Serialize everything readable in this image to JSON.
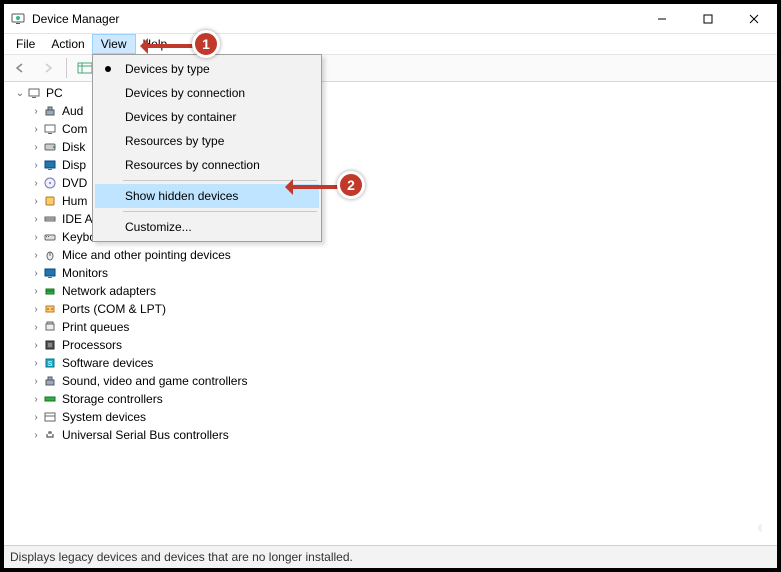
{
  "title": "Device Manager",
  "menus": {
    "file": "File",
    "action": "Action",
    "view": "View",
    "help": "Help"
  },
  "view_menu": {
    "devices_by_type": "Devices by type",
    "devices_by_connection": "Devices by connection",
    "devices_by_container": "Devices by container",
    "resources_by_type": "Resources by type",
    "resources_by_connection": "Resources by connection",
    "show_hidden": "Show hidden devices",
    "customize": "Customize..."
  },
  "tree": {
    "root": "PC",
    "items": [
      "Audio",
      "Computer",
      "Disk drives",
      "Display adapters",
      "DVD/CD-ROM drives",
      "Human Interface Devices",
      "IDE ATA/ATAPI controllers",
      "Keyboards",
      "Mice and other pointing devices",
      "Monitors",
      "Network adapters",
      "Ports (COM & LPT)",
      "Print queues",
      "Processors",
      "Software devices",
      "Sound, video and game controllers",
      "Storage controllers",
      "System devices",
      "Universal Serial Bus controllers"
    ],
    "items_trunc": [
      "Aud",
      "Com",
      "Disk",
      "Disp",
      "DVD",
      "Hum",
      "IDE A"
    ]
  },
  "statusbar": "Displays legacy devices and devices that are no longer installed.",
  "annotations": {
    "one": "1",
    "two": "2"
  }
}
